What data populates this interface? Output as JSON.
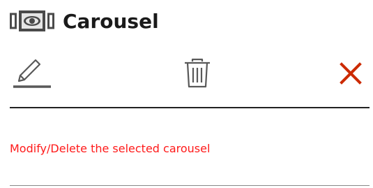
{
  "header": {
    "title": "Carousel",
    "icon": "carousel-icon"
  },
  "toolbar": {
    "edit_icon": "pencil-edit-icon",
    "delete_icon": "trash-icon",
    "close_icon": "close-x-icon"
  },
  "message": {
    "text": "Modify/Delete the selected carousel"
  },
  "colors": {
    "message": "#ff1a1a",
    "close": "#cc2a00",
    "icon_gray": "#595959",
    "title": "#1a1a1a"
  }
}
